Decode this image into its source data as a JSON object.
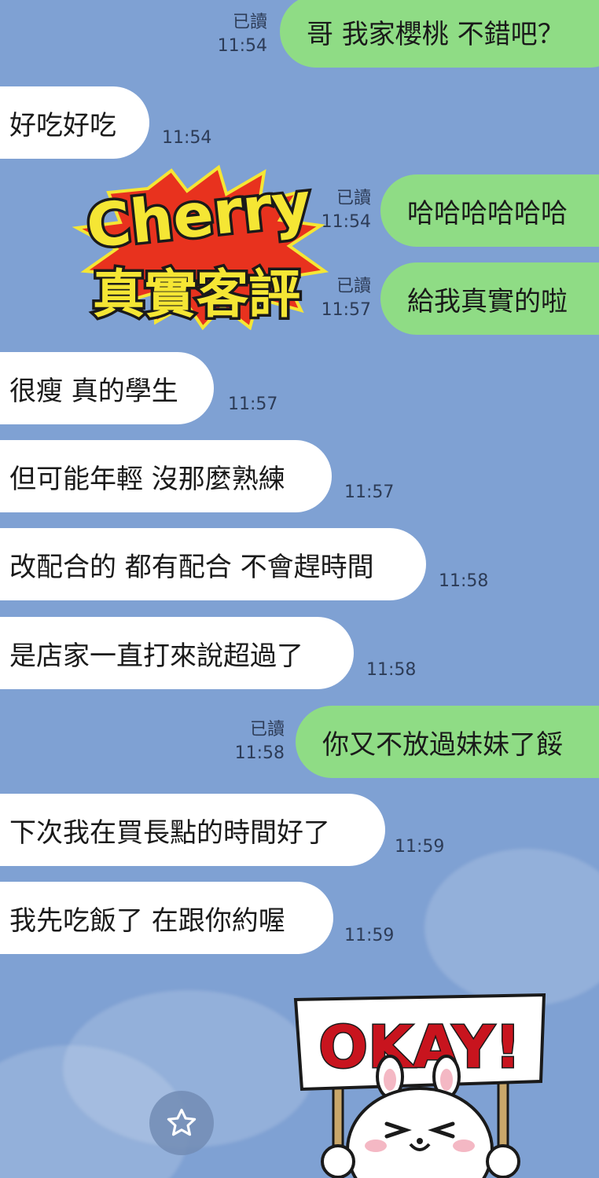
{
  "messages": [
    {
      "side": "out",
      "text": "哥 我家櫻桃 不錯吧？",
      "read": "已讀",
      "time": "11:54"
    },
    {
      "side": "in",
      "text": "好吃好吃",
      "time": "11:54"
    },
    {
      "side": "out",
      "text": "哈哈哈哈哈哈",
      "read": "已讀",
      "time": "11:54"
    },
    {
      "side": "out",
      "text": "給我真實的啦",
      "read": "已讀",
      "time": "11:57"
    },
    {
      "side": "in",
      "text": "很瘦 真的學生",
      "time": "11:57"
    },
    {
      "side": "in",
      "text": "但可能年輕 沒那麼熟練",
      "time": "11:57"
    },
    {
      "side": "in",
      "text": "改配合的 都有配合 不會趕時間",
      "time": "11:58"
    },
    {
      "side": "in",
      "text": "是店家一直打來說超過了",
      "time": "11:58"
    },
    {
      "side": "out",
      "text": "你又不放過妹妹了餒",
      "read": "已讀",
      "time": "11:58"
    },
    {
      "side": "in",
      "text": "下次我在買長點的時間好了",
      "time": "11:59"
    },
    {
      "side": "in",
      "text": "我先吃飯了 在跟你約喔",
      "time": "11:59"
    }
  ],
  "badge": {
    "line1": "Cherry",
    "line2": "真實客評"
  },
  "sticker": {
    "text": "OKAY!"
  },
  "icons": {
    "favorite": "star-icon"
  },
  "colors": {
    "background": "#7fa1d3",
    "incoming_bubble": "#ffffff",
    "outgoing_bubble": "#8fdc85",
    "badge_yellow": "#f5e634",
    "badge_red": "#e8321e",
    "sticker_red": "#c8141e"
  }
}
